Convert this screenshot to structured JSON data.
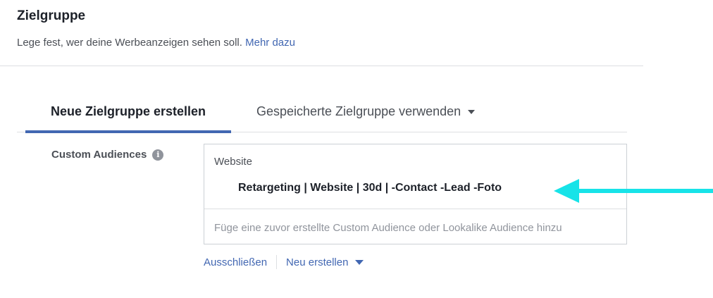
{
  "header": {
    "title": "Zielgruppe",
    "subtitle": "Lege fest, wer deine Werbeanzeigen sehen soll.",
    "learn_more": "Mehr dazu"
  },
  "tabs": [
    {
      "label": "Neue Zielgruppe erstellen",
      "active": true
    },
    {
      "label": "Gespeicherte Zielgruppe verwenden",
      "active": false
    }
  ],
  "custom_audiences": {
    "label": "Custom Audiences",
    "info_icon": "info-icon",
    "category": "Website",
    "selected": "Retargeting | Website | 30d | -Contact -Lead -Foto",
    "placeholder": "Füge eine zuvor erstellte Custom Audience oder Lookalike Audience hinzu"
  },
  "actions": {
    "exclude": "Ausschließen",
    "create_new": "Neu erstellen"
  },
  "colors": {
    "accent": "#4267b2",
    "annotation_arrow": "#17e3e8"
  }
}
